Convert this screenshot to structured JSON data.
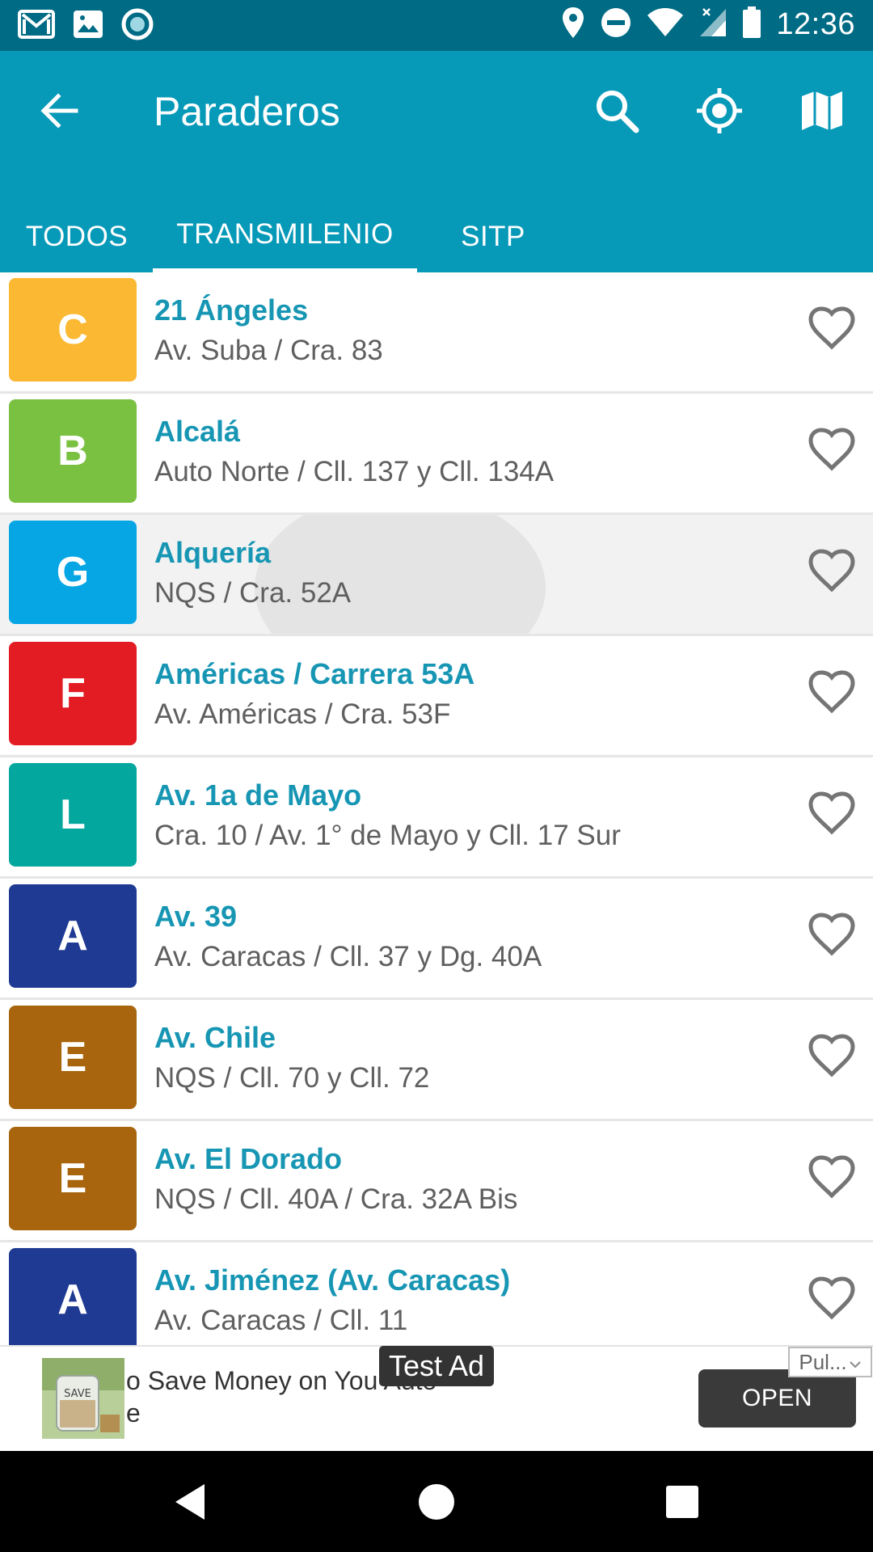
{
  "status_bar": {
    "time": "12:36",
    "left_icons": [
      "gmail-icon",
      "image-icon",
      "circle-app-icon"
    ],
    "right_icons": [
      "location-icon",
      "do-not-disturb-icon",
      "wifi-icon",
      "signal-icon",
      "battery-icon"
    ]
  },
  "app_bar": {
    "title": "Paraderos",
    "actions": [
      "search-icon",
      "my-location-icon",
      "map-icon"
    ],
    "color": "#0799b8"
  },
  "tabs": [
    {
      "label": "TODOS",
      "active": false
    },
    {
      "label": "TRANSMILENIO",
      "active": true
    },
    {
      "label": "SITP",
      "active": false
    }
  ],
  "stations": [
    {
      "letter": "C",
      "color": "#fbb832",
      "name": "21 Ángeles",
      "address": "Av. Suba / Cra. 83"
    },
    {
      "letter": "B",
      "color": "#7ac142",
      "name": "Alcalá",
      "address": "Auto Norte / Cll. 137 y Cll. 134A"
    },
    {
      "letter": "G",
      "color": "#06a6e5",
      "name": "Alquería",
      "address": "NQS / Cra. 52A"
    },
    {
      "letter": "F",
      "color": "#e31c23",
      "name": "Américas / Carrera 53A",
      "address": "Av. Américas / Cra. 53F"
    },
    {
      "letter": "L",
      "color": "#04a79e",
      "name": "Av. 1a de Mayo",
      "address": "Cra. 10 / Av. 1° de Mayo y Cll. 17 Sur"
    },
    {
      "letter": "A",
      "color": "#1f3a93",
      "name": "Av. 39",
      "address": "Av. Caracas / Cll. 37 y Dg. 40A"
    },
    {
      "letter": "E",
      "color": "#a8650d",
      "name": "Av. Chile",
      "address": "NQS / Cll. 70 y Cll. 72"
    },
    {
      "letter": "E",
      "color": "#a8650d",
      "name": "Av. El Dorado",
      "address": "NQS / Cll. 40A / Cra. 32A Bis"
    },
    {
      "letter": "A",
      "color": "#1f3a93",
      "name": "Av. Jiménez (Av. Caracas)",
      "address": "Av. Caracas / Cll. 11"
    }
  ],
  "ad": {
    "test_label": "Test Ad",
    "line1": "o Save Money on You  Auto",
    "line2": "e",
    "image_label": "SAVE",
    "open_label": "OPEN",
    "choice_label": "Pul..."
  },
  "nav": [
    "back-icon",
    "home-icon",
    "recents-icon"
  ]
}
